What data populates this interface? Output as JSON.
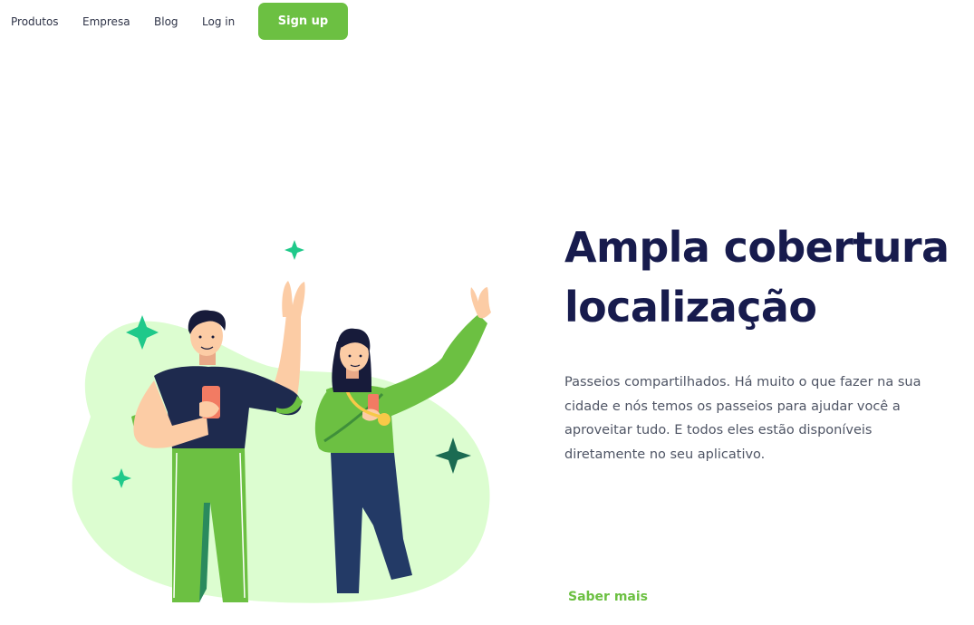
{
  "nav": {
    "links": [
      "Produtos",
      "Empresa",
      "Blog",
      "Log in"
    ],
    "signup_label": "Sign up"
  },
  "hero": {
    "title_line1": "Ampla cobertura",
    "title_line2": "localização",
    "description": "Passeios compartilhados. Há muito o que fazer na sua cidade e nós temos os passeios para ajudar você a aproveitar tudo. E todos eles estão disponíveis diretamente no seu aplicativo.",
    "cta_label": "Saber mais"
  },
  "colors": {
    "brand_green": "#6cc042",
    "title_navy": "#171b4d",
    "blob_green": "#dcfdd0",
    "sparkle_teal": "#1fc98a",
    "sparkle_dark": "#1b6b52"
  },
  "illustration": {
    "icons": [
      "sparkle-icon",
      "man-waving-with-phone",
      "woman-waving-with-phone"
    ]
  }
}
